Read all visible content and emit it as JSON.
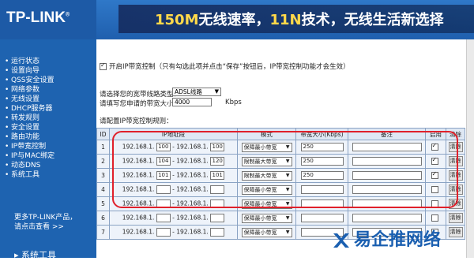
{
  "banner": {
    "logo": "TP-LINK",
    "logo_mark": "®",
    "slogan_part1": "150M",
    "slogan_part2": "无线速率，",
    "slogan_part3": "11N",
    "slogan_part4": "技术，无线生活新选择"
  },
  "sidebar": {
    "items": [
      "运行状态",
      "设置向导",
      "QSS安全设置",
      "网络参数",
      "无线设置",
      "DHCP服务器",
      "转发规则",
      "安全设置",
      "路由功能",
      "IP带宽控制",
      "IP与MAC绑定",
      "动态DNS",
      "系统工具"
    ],
    "more_line1": "更多TP-LINK产品，",
    "more_line2": "请点击查看 >>",
    "footer": "系统工具"
  },
  "content": {
    "enable_label": "开启IP带宽控制（只有勾选此项并点击“保存”按钮后，IP带宽控制功能才会生效）",
    "enable_checked": true,
    "line_type_label": "请选择您的宽带线路类型：",
    "line_type_value": "ADSL线路",
    "bandwidth_label": "请填写您申请的带宽大小：",
    "bandwidth_value": "4000",
    "bandwidth_unit": "Kbps",
    "rules_label": "请配置IP带宽控制规则："
  },
  "table": {
    "headers": {
      "id": "ID",
      "ip": "IP地址段",
      "mode": "模式",
      "bw": "带宽大小(Kbps)",
      "note": "备注",
      "enable": "启用",
      "delete": "清除"
    },
    "rows": [
      {
        "id": "1",
        "prefix": "192.168.1.",
        "start": "100",
        "sep": "- 192.168.1.",
        "end": "100",
        "mode": "保障最小带宽",
        "bw": "250",
        "enabled": true,
        "del": "清除"
      },
      {
        "id": "2",
        "prefix": "192.168.1.",
        "start": "104",
        "sep": "- 192.168.1.",
        "end": "120",
        "mode": "限制最大带宽",
        "bw": "250",
        "enabled": true,
        "del": "清除"
      },
      {
        "id": "3",
        "prefix": "192.168.1.",
        "start": "101",
        "sep": "- 192.168.1.",
        "end": "101",
        "mode": "限制最大带宽",
        "bw": "250",
        "enabled": true,
        "del": "清除"
      },
      {
        "id": "4",
        "prefix": "192.168.1.",
        "start": "",
        "sep": "- 192.168.1.",
        "end": "",
        "mode": "保障最小带宽",
        "bw": "",
        "enabled": false,
        "del": "清除"
      },
      {
        "id": "5",
        "prefix": "192.168.1.",
        "start": "",
        "sep": "- 192.168.1.",
        "end": "",
        "mode": "保障最小带宽",
        "bw": "",
        "enabled": false,
        "del": "清除"
      },
      {
        "id": "6",
        "prefix": "192.168.1.",
        "start": "",
        "sep": "- 192.168.1.",
        "end": "",
        "mode": "保障最小带宽",
        "bw": "",
        "enabled": false,
        "del": "清除"
      },
      {
        "id": "7",
        "prefix": "192.168.1.",
        "start": "",
        "sep": "- 192.168.1.",
        "end": "",
        "mode": "保障最小带宽",
        "bw": "",
        "enabled": false,
        "del": "清除"
      }
    ]
  },
  "watermark": {
    "text": "易企推网络"
  },
  "colors": {
    "sidebar_bg": "#1e63b0",
    "highlight_red": "#e0202a",
    "slogan_yellow": "#ffd94a"
  }
}
